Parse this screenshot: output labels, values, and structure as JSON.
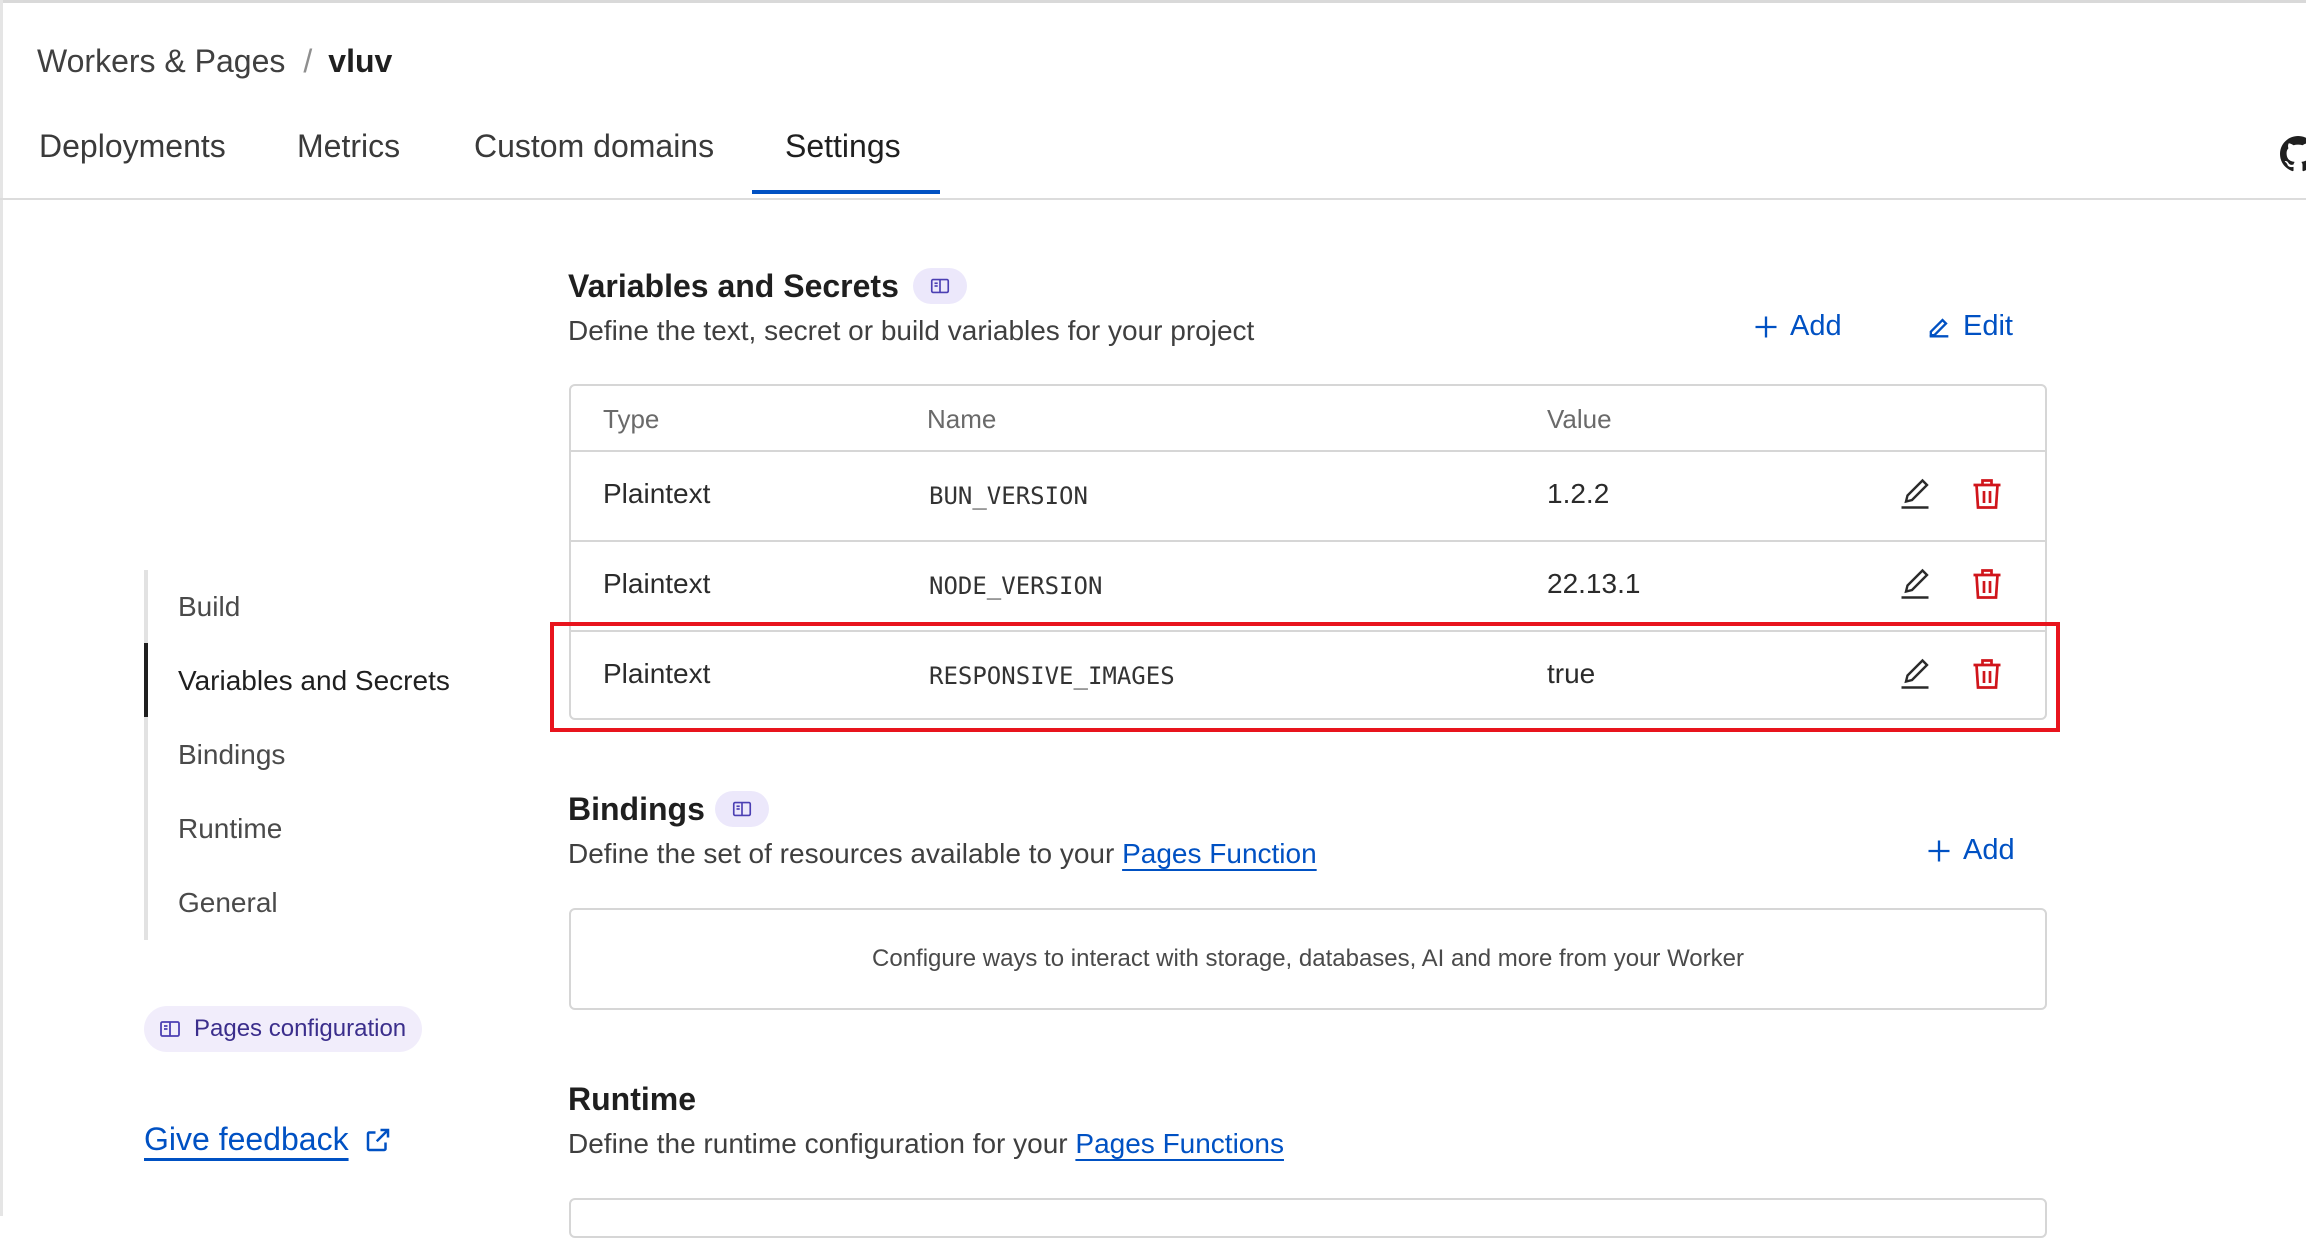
{
  "breadcrumb": {
    "parent": "Workers & Pages",
    "separator": "/",
    "current": "vluv"
  },
  "tabs": [
    {
      "label": "Deployments"
    },
    {
      "label": "Metrics"
    },
    {
      "label": "Custom domains"
    },
    {
      "label": "Settings",
      "active": true
    }
  ],
  "sidenav": {
    "items": [
      {
        "label": "Build"
      },
      {
        "label": "Variables and Secrets",
        "active": true
      },
      {
        "label": "Bindings"
      },
      {
        "label": "Runtime"
      },
      {
        "label": "General"
      }
    ],
    "config_pill": "Pages configuration",
    "feedback": "Give feedback"
  },
  "variables": {
    "title": "Variables and Secrets",
    "description": "Define the text, secret or build variables for your project",
    "add_label": "Add",
    "edit_label": "Edit",
    "columns": [
      "Type",
      "Name",
      "Value"
    ],
    "rows": [
      {
        "type": "Plaintext",
        "name": "BUN_VERSION",
        "value": "1.2.2"
      },
      {
        "type": "Plaintext",
        "name": "NODE_VERSION",
        "value": "22.13.1"
      },
      {
        "type": "Plaintext",
        "name": "RESPONSIVE_IMAGES",
        "value": "true"
      }
    ]
  },
  "bindings": {
    "title": "Bindings",
    "description_prefix": "Define the set of resources available to your",
    "description_link": "Pages Function",
    "add_label": "Add",
    "empty_text": "Configure ways to interact with storage, databases, AI and more from your Worker"
  },
  "runtime": {
    "title": "Runtime",
    "description_prefix": "Define the runtime configuration for your",
    "description_link": "Pages Functions"
  },
  "colors": {
    "accent": "#0051c3",
    "danger": "#d0151b",
    "highlight": "#e8141d",
    "badge_bg": "#ece8fb"
  }
}
